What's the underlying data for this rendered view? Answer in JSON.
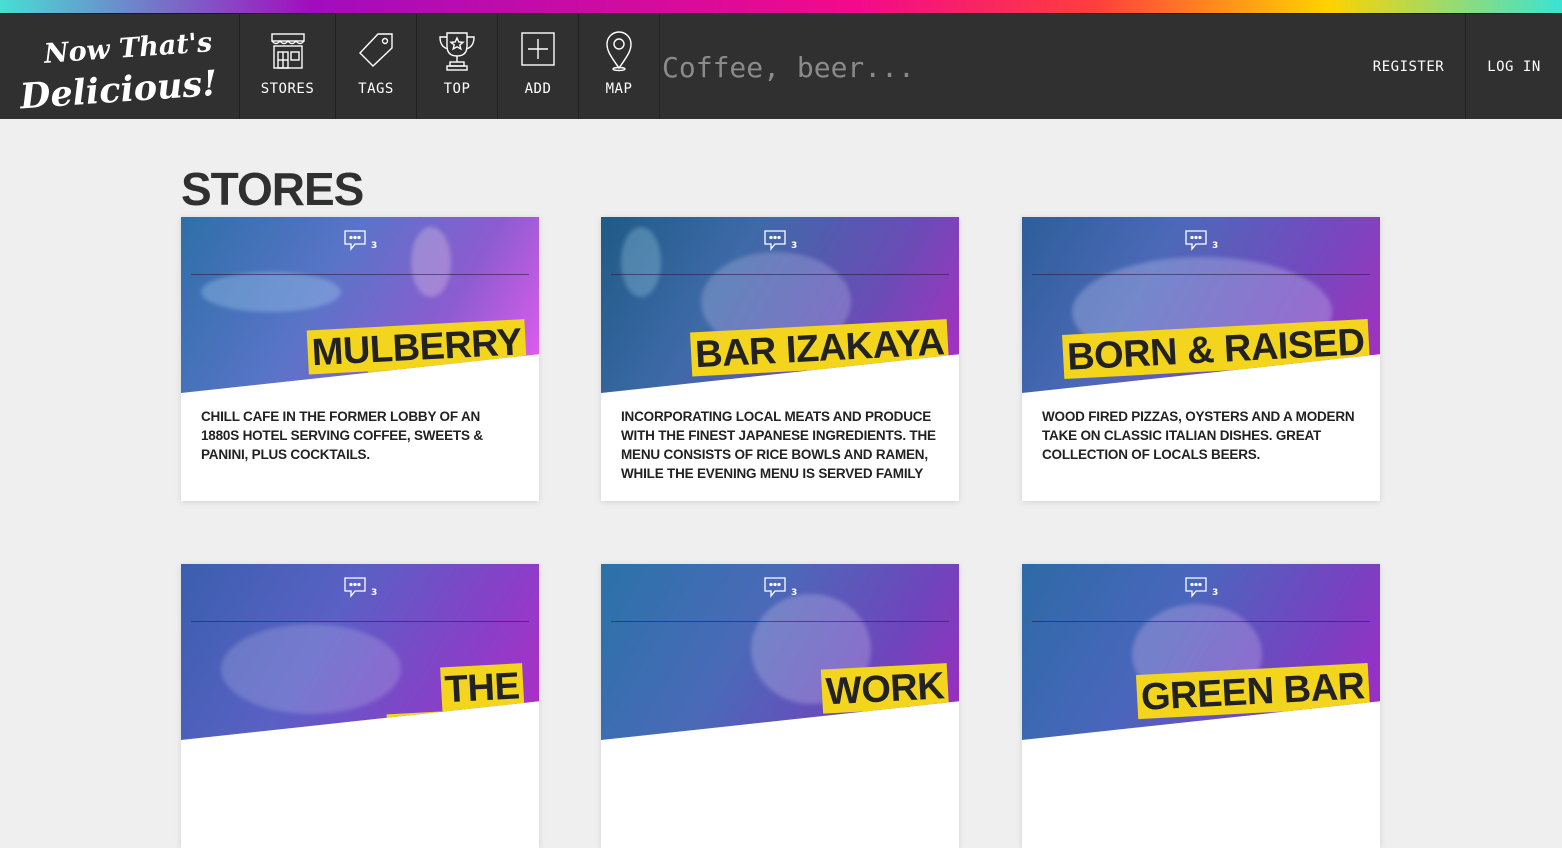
{
  "brand": {
    "logo_line1": "Now That's",
    "logo_line2": "Delicious!"
  },
  "colors": {
    "accent_yellow": "#f3d51d",
    "nav_bg": "#303030",
    "page_bg": "#efefef"
  },
  "nav": {
    "items": [
      {
        "label": "STORES",
        "icon": "store-icon"
      },
      {
        "label": "TAGS",
        "icon": "tag-icon"
      },
      {
        "label": "TOP",
        "icon": "trophy-icon"
      },
      {
        "label": "ADD",
        "icon": "add-icon"
      },
      {
        "label": "MAP",
        "icon": "map-pin-icon"
      }
    ],
    "search_placeholder": "Coffee, beer...",
    "register_label": "REGISTER",
    "login_label": "LOG IN"
  },
  "page": {
    "title": "STORES"
  },
  "stores": [
    {
      "name": "Mulberry Coffee",
      "reviews": "3",
      "description": "Chill cafe in the former lobby of an 1880s hotel serving coffee, sweets & panini, plus cocktails."
    },
    {
      "name": "Bar Izakaya",
      "reviews": "3",
      "description": "Incorporating local meats and produce with the finest Japanese ingredients. The menu consists of rice bowls and ramen, while the evening menu is served family"
    },
    {
      "name": "Born & Raised",
      "reviews": "3",
      "description": "Wood fired pizzas, oysters and a modern take on classic Italian dishes. Great collection of locals beers."
    },
    {
      "name": "The Burnt Tongue",
      "reviews": "3",
      "description": ""
    },
    {
      "name": "Work",
      "reviews": "3",
      "description": ""
    },
    {
      "name": "Green Bar",
      "reviews": "3",
      "description": ""
    }
  ]
}
